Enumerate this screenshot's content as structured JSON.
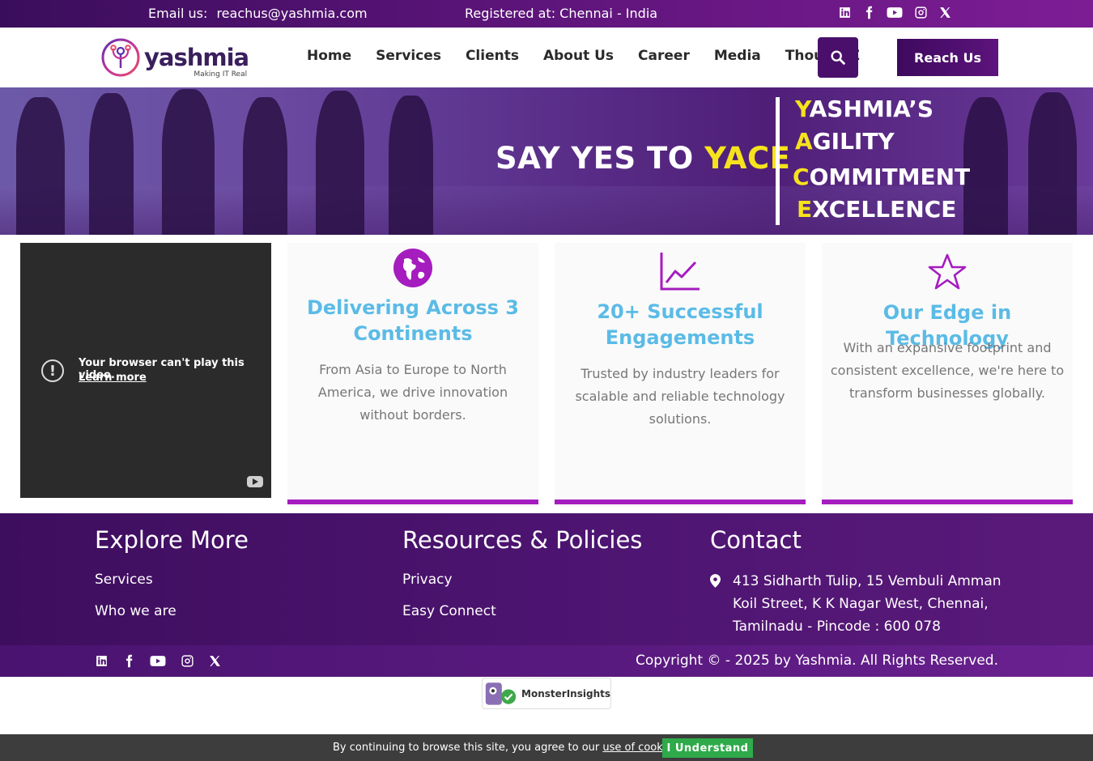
{
  "topbar": {
    "email_label": "Email us:",
    "email": "reachus@yashmia.com",
    "registered": "Registered at: Chennai - India",
    "socials": [
      "linkedin-icon",
      "facebook-icon",
      "youtube-icon",
      "instagram-icon",
      "x-icon"
    ]
  },
  "header": {
    "logo_word": "yashmia",
    "logo_tagline": "Making IT Real",
    "nav": [
      "Home",
      "Services",
      "Clients",
      "About Us",
      "Career",
      "Media",
      "ThoughtZ"
    ],
    "reach_label": "Reach Us"
  },
  "hero": {
    "title_prefix": "SAY YES TO ",
    "title_highlight": "YACE",
    "acronym": [
      {
        "first": "Y",
        "rest": "ASHMIA’S"
      },
      {
        "first": "A",
        "rest": "GILITY"
      },
      {
        "first": "C",
        "rest": "OMMITMENT"
      },
      {
        "first": "E",
        "rest": "XCELLENCE"
      }
    ]
  },
  "video": {
    "message": "Your browser can't play this video.",
    "link": "Learn more"
  },
  "cards": [
    {
      "icon": "globe-icon",
      "title": "Delivering Across 3 Continents",
      "text": "From Asia to Europe to North America, we drive innovation without borders."
    },
    {
      "icon": "line-chart-icon",
      "title": "20+ Successful Engagements",
      "text": "Trusted by industry leaders for scalable and reliable technology solutions."
    },
    {
      "icon": "star-icon",
      "title": "Our Edge in Technology",
      "text": "With an expansive footprint and consistent excellence, we're here to transform businesses globally."
    }
  ],
  "footer": {
    "explore_title": "Explore More",
    "explore_links": [
      "Services",
      "Who we are"
    ],
    "resources_title": "Resources & Policies",
    "resources_links": [
      "Privacy",
      "Easy Connect"
    ],
    "contact_title": "Contact",
    "address": "413 Sidharth Tulip, 15 Vembuli Amman Koil Street, K K Nagar West, Chennai, Tamilnadu - Pincode : 600 078",
    "copyright": "Copyright © - 2025 by Yashmia. All Rights Reserved."
  },
  "badge": {
    "text": "MonsterInsights"
  },
  "cookie": {
    "text": "By continuing to browse this site, you agree to our ",
    "link": "use of cookies",
    "period": ".",
    "button": "I Understand"
  },
  "colors": {
    "brand_purple": "#4a0f6b",
    "accent_magenta": "#a51cbf",
    "hero_yellow": "#f6e21d",
    "card_title_blue": "#5bbbe6",
    "cookie_green": "#2eaa4a"
  }
}
